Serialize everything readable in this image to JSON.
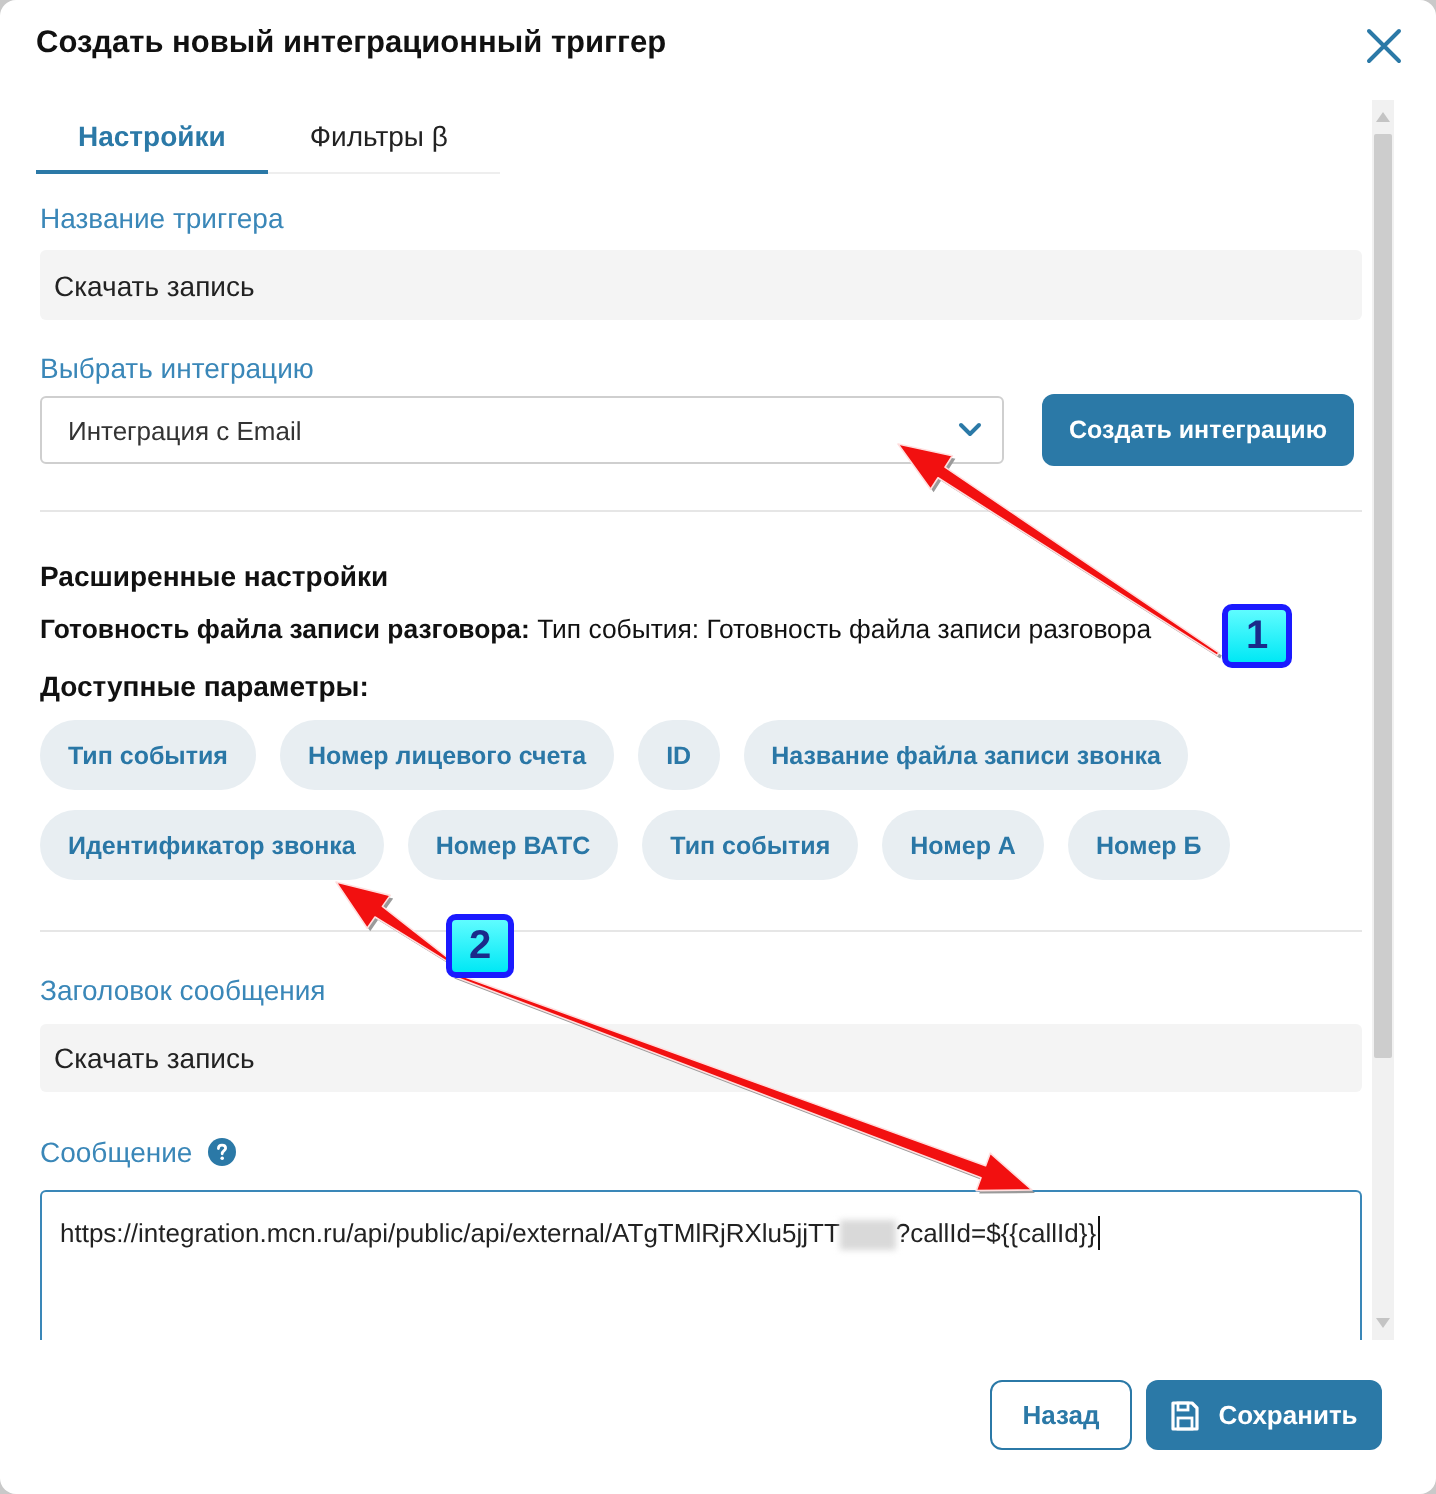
{
  "window": {
    "title": "Создать новый интеграционный триггер"
  },
  "tabs": [
    {
      "label": "Настройки",
      "selected": true
    },
    {
      "label": "Фильтры β",
      "selected": false
    }
  ],
  "trigger_name": {
    "label": "Название триггера",
    "value": "Скачать запись"
  },
  "integration": {
    "label": "Выбрать интеграцию",
    "value": "Интеграция с Email",
    "create_button": "Создать интеграцию"
  },
  "advanced_settings": {
    "title": "Расширенные настройки",
    "event_text": "**Готовность файла записи разговора:** Тип события: Готовность файла записи разговора",
    "parameters_title": "Доступные параметры:",
    "parameters": [
      "Тип события",
      "Номер лицевого счета",
      "ID",
      "Название файла записи звонка",
      "Идентификатор звонка",
      "Номер ВАТС",
      "Тип события",
      "Номер А",
      "Номер Б"
    ]
  },
  "message_subject": {
    "label": "Заголовок сообщения",
    "value": "Скачать запись"
  },
  "message": {
    "label": "Сообщение",
    "focused": true,
    "redacted": true,
    "value_start": "https://integration.mcn.ru/api/public/api/external/ATgTMlRjRXlu5jjTT",
    "value_end": "?callId=${{callId}}"
  },
  "footer": {
    "buttons": [
      {
        "label": "Назад",
        "kind": "secondary"
      },
      {
        "label": "Сохранить",
        "kind": "primary"
      }
    ]
  },
  "annotations": [
    {
      "label": "1"
    },
    {
      "label": "2"
    }
  ]
}
